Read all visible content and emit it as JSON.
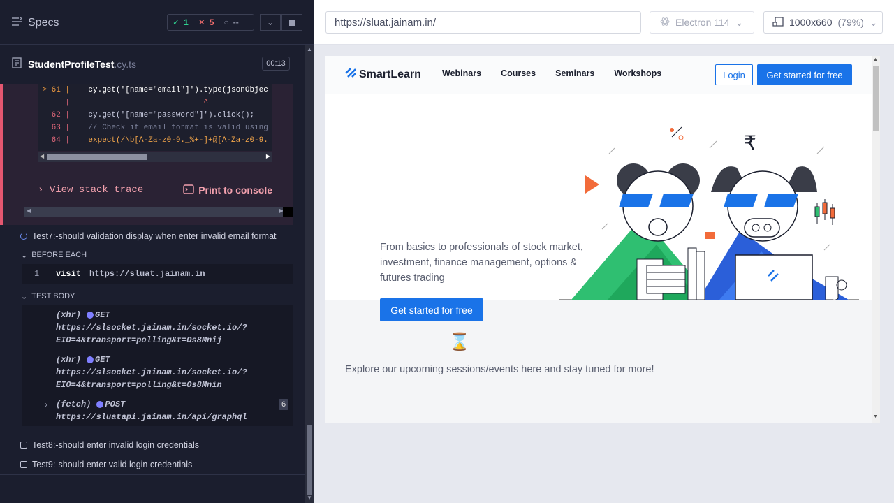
{
  "reporter": {
    "specs_label": "Specs",
    "stats": {
      "passed": "1",
      "failed": "5",
      "pending": "--"
    },
    "spec_name": "StudentProfileTest",
    "spec_ext": ".cy.ts",
    "timer": "00:13",
    "code_lines": [
      {
        "num": "> 61 |",
        "code": "    cy.get('[name=\"email\"]').type(jsonObjec"
      },
      {
        "num": "     |",
        "code": "                             ^"
      },
      {
        "num": "62 |",
        "code": "    cy.get('[name=\"password\"]').click();"
      },
      {
        "num": "63 |",
        "code": "    // Check if email format is valid using"
      },
      {
        "num": "64 |",
        "code": "    expect(/\\b[A-Za-z0-9._%+-]+@[A-Za-z0-9."
      }
    ],
    "view_stack_trace": "View stack trace",
    "print_to_console": "Print to console",
    "test7": "Test7:-should validation display when enter invalid email format",
    "before_each": "BEFORE EACH",
    "visit_num": "1",
    "visit_cmd": "visit",
    "visit_url": "https://sluat.jainam.in",
    "test_body": "TEST BODY",
    "xhr1_type": "(xhr)",
    "xhr1_method": "GET",
    "xhr1_url1": "https://slsocket.jainam.in/socket.io/?",
    "xhr1_url2": "EIO=4&transport=polling&t=Os8Mnij",
    "xhr2_type": "(xhr)",
    "xhr2_method": "GET",
    "xhr2_url1": "https://slsocket.jainam.in/socket.io/?",
    "xhr2_url2": "EIO=4&transport=polling&t=Os8Mnin",
    "fetch_type": "(fetch)",
    "fetch_method": "POST",
    "fetch_url": "https://sluatapi.jainam.in/api/graphql",
    "fetch_count": "6",
    "test8": "Test8:-should enter invalid login credentials",
    "test9": "Test9:-should enter valid login credentials"
  },
  "aut": {
    "url": "https://sluat.jainam.in/",
    "browser": "Electron 114",
    "viewport": "1000x660",
    "zoom": "(79%)"
  },
  "site": {
    "logo": "SmartLearn",
    "nav": [
      "Webinars",
      "Courses",
      "Seminars",
      "Workshops"
    ],
    "login": "Login",
    "get_started_nav": "Get started for free",
    "hero_text": "From basics to professionals of stock market, investment, finance management, options & futures trading",
    "get_started_hero": "Get started for free",
    "explore": "Explore our upcoming sessions/events here and stay tuned for more!"
  },
  "colors": {
    "accent": "#1a73e8",
    "pass": "#2fd18f",
    "fail": "#f16d6d",
    "error_border": "#e45770"
  }
}
